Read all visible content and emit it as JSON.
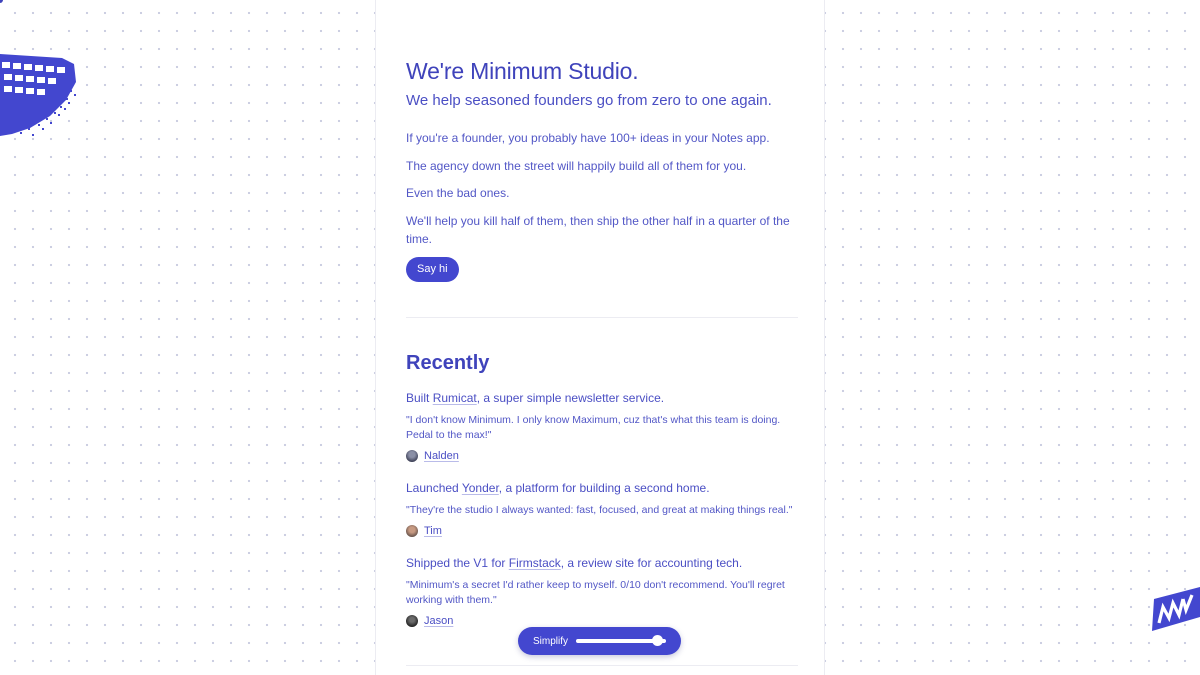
{
  "hero": {
    "title": "We're Minimum Studio.",
    "subtitle": "We help seasoned founders go from zero to one again.",
    "paragraphs": [
      "If you're a founder, you probably have 100+ ideas in your Notes app.",
      "The agency down the street will happily build all of them for you.",
      "Even the bad ones.",
      "We'll help you kill half of them, then ship the other half in a quarter of the time."
    ],
    "cta_label": "Say hi"
  },
  "recently": {
    "title": "Recently",
    "entries": [
      {
        "prefix": "Built ",
        "link": "Rumicat",
        "suffix": ", a super simple newsletter service.",
        "quote": "\"I don't know Minimum. I only know Maximum, cuz that's what this team is doing. Pedal to the max!\"",
        "author": "Nalden"
      },
      {
        "prefix": "Launched ",
        "link": "Yonder",
        "suffix": ", a platform for building a second home.",
        "quote": "\"They're the studio I always wanted: fast, focused, and great at making things real.\"",
        "author": "Tim"
      },
      {
        "prefix": "Shipped the V1 for ",
        "link": "Firmstack",
        "suffix": ", a review site for accounting tech.",
        "quote": "\"Minimum's a secret I'd rather keep to myself. 0/10 don't recommend. You'll regret working with them.\"",
        "author": "Jason"
      }
    ]
  },
  "simplify": {
    "label": "Simplify",
    "value": 0.9
  },
  "colors": {
    "accent": "#4347cf",
    "text": "#4b4fc4",
    "background": "#ffffff",
    "divider": "#ececf2"
  },
  "icons": [
    "pixel-keyboard-logo",
    "pixel-m-logo"
  ]
}
